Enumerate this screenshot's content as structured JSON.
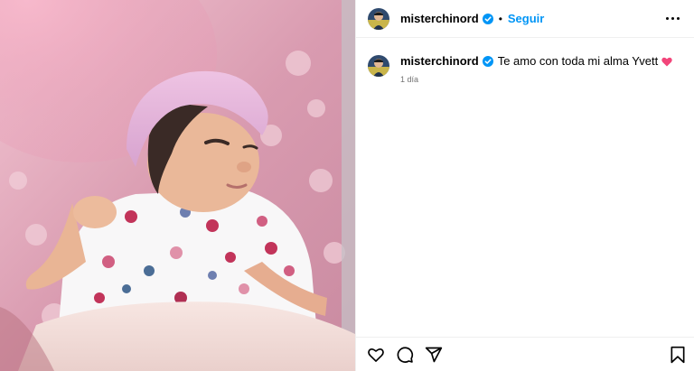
{
  "post": {
    "username": "misterchinord",
    "follow_label": "Seguir",
    "separator": "•",
    "caption": "Te amo con toda mi alma Yvett",
    "time_ago": "1 día"
  },
  "icons": {
    "verified": "verified-badge-icon",
    "more": "more-options-icon",
    "like": "heart-icon",
    "comment": "comment-icon",
    "share": "share-icon",
    "save": "bookmark-icon",
    "caption_emoji": "pink-heart-emoji"
  },
  "colors": {
    "accent": "#0095f6",
    "secondary_text": "#737373",
    "emoji_heart": "#f2457a",
    "border": "#efefef"
  }
}
